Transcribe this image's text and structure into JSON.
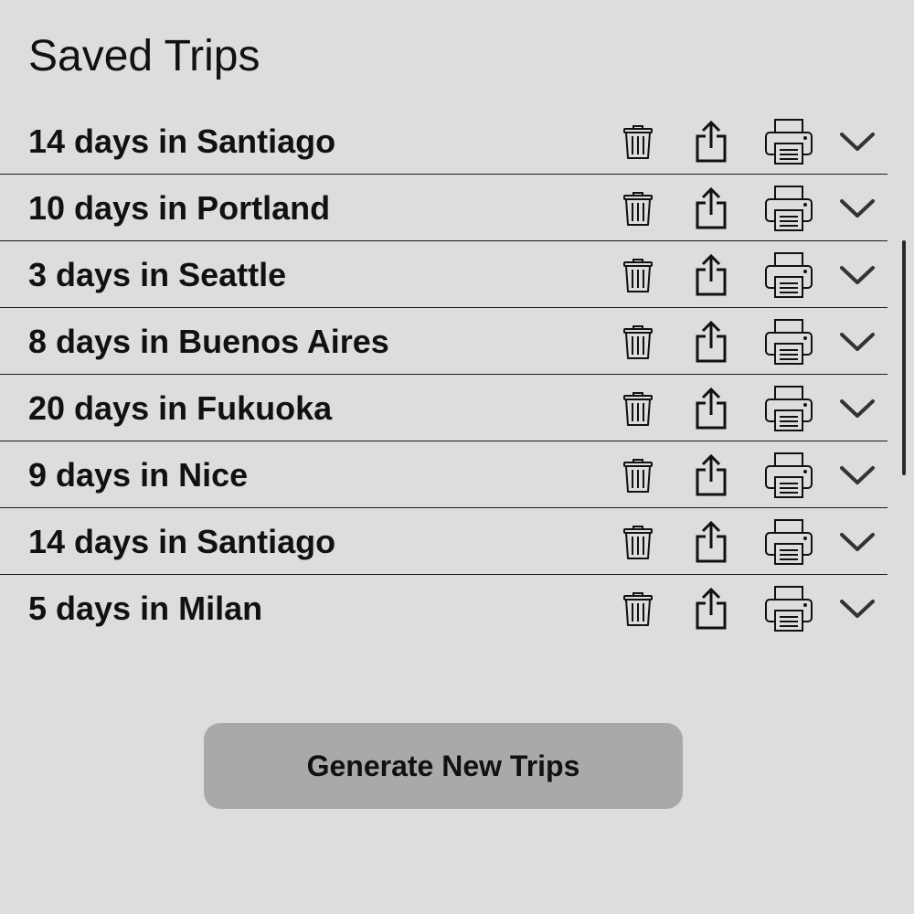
{
  "header": {
    "title": "Saved Trips"
  },
  "trips": [
    {
      "label": "14 days in Santiago"
    },
    {
      "label": "10 days in Portland"
    },
    {
      "label": "3 days in Seattle"
    },
    {
      "label": "8 days in Buenos Aires"
    },
    {
      "label": "20 days in Fukuoka"
    },
    {
      "label": "9 days in Nice"
    },
    {
      "label": "14 days in Santiago"
    },
    {
      "label": "5 days in Milan"
    }
  ],
  "row_actions": {
    "icons": [
      "trash-icon",
      "share-icon",
      "printer-icon",
      "chevron-down-icon"
    ]
  },
  "footer": {
    "generate_label": "Generate New Trips"
  },
  "colors": {
    "background": "#dddddd",
    "button": "#a9a9a9",
    "text": "#111111"
  }
}
